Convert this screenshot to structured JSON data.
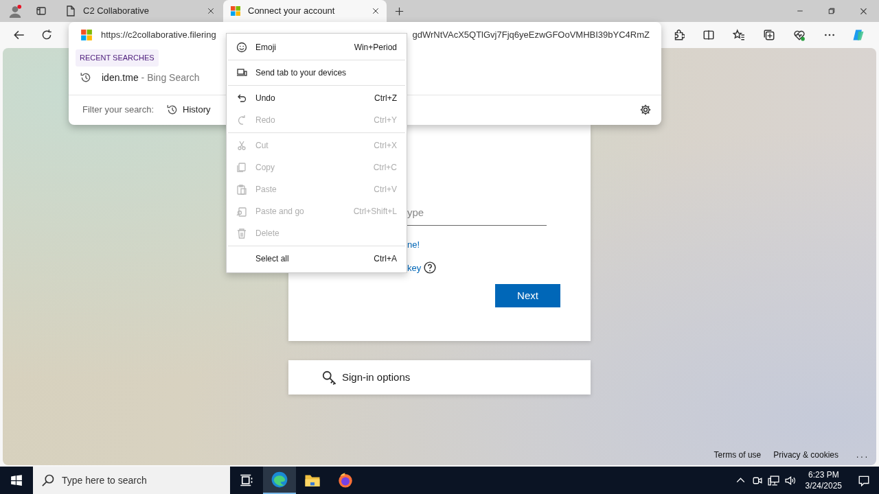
{
  "browser": {
    "tabs": [
      {
        "title": "C2 Collaborative",
        "selected": false
      },
      {
        "title": "Connect your account",
        "selected": true
      }
    ]
  },
  "address_dropdown": {
    "url": "https://c2collaborative.filering",
    "url_tail": "gdWrNtVAcX5QTlGvj7Fjq6yeEzwGFOoVMHBI39bYC4RmZ",
    "section_label": "RECENT SEARCHES",
    "suggestions": [
      {
        "query": "iden.tme",
        "source": "- Bing Search"
      }
    ],
    "filter_label": "Filter your search:",
    "filter_chips": [
      "History"
    ]
  },
  "context_menu": {
    "items": [
      {
        "kind": "item",
        "label": "Emoji",
        "shortcut": "Win+Period",
        "disabled": false
      },
      {
        "kind": "divider"
      },
      {
        "kind": "item",
        "label": "Send tab to your devices",
        "disabled": false
      },
      {
        "kind": "divider"
      },
      {
        "kind": "item",
        "label": "Undo",
        "shortcut": "Ctrl+Z",
        "disabled": false
      },
      {
        "kind": "item",
        "label": "Redo",
        "shortcut": "Ctrl+Y",
        "disabled": true
      },
      {
        "kind": "divider"
      },
      {
        "kind": "item",
        "label": "Cut",
        "shortcut": "Ctrl+X",
        "disabled": true
      },
      {
        "kind": "item",
        "label": "Copy",
        "shortcut": "Ctrl+C",
        "disabled": true
      },
      {
        "kind": "item",
        "label": "Paste",
        "shortcut": "Ctrl+V",
        "disabled": true
      },
      {
        "kind": "item",
        "label": "Paste and go",
        "shortcut": "Ctrl+Shift+L",
        "disabled": true
      },
      {
        "kind": "item",
        "label": "Delete",
        "disabled": true
      },
      {
        "kind": "divider"
      },
      {
        "kind": "item",
        "label": "Select all",
        "shortcut": "Ctrl+A",
        "disabled": false
      }
    ]
  },
  "page": {
    "field": {
      "placeholder": "ype"
    },
    "link_1": "ne!",
    "link_2": "key",
    "next_button": "Next",
    "sign_in_options": "Sign-in options",
    "footer_links": [
      "Terms of use",
      "Privacy & cookies"
    ],
    "more": "..."
  },
  "taskbar": {
    "search_placeholder": "Type here to search",
    "time": "6:23 PM",
    "date": "3/24/2025"
  }
}
